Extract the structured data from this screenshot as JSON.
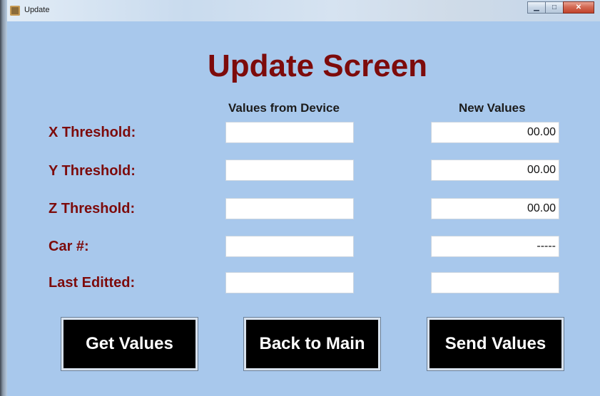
{
  "window": {
    "title": "Update",
    "controls": [
      "minimize",
      "maximize",
      "close"
    ]
  },
  "heading": "Update Screen",
  "columns": {
    "device": "Values from Device",
    "new": "New Values"
  },
  "rows": [
    {
      "label": "X Threshold:",
      "device_value": "",
      "new_value": "00.00"
    },
    {
      "label": "Y Threshold:",
      "device_value": "",
      "new_value": "00.00"
    },
    {
      "label": "Z Threshold:",
      "device_value": "",
      "new_value": "00.00"
    },
    {
      "label": "Car #:",
      "device_value": "",
      "new_value": "-----"
    },
    {
      "label": "Last Editted:",
      "device_value": "",
      "new_value": ""
    }
  ],
  "buttons": {
    "get": "Get Values",
    "back": "Back to Main",
    "send": "Send Values"
  },
  "colors": {
    "background": "#a8c8ec",
    "label": "#7d0b0b",
    "button": "#000000"
  }
}
